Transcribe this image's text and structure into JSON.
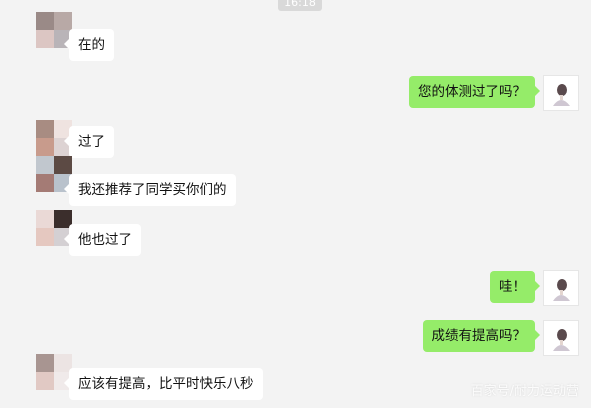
{
  "timestamp": "16:18",
  "colors": {
    "background": "#f3f3f3",
    "sent_bubble": "#95ec69",
    "received_bubble": "#ffffff"
  },
  "messages": [
    {
      "side": "left",
      "text": "在的"
    },
    {
      "side": "right",
      "text": "您的体测过了吗？"
    },
    {
      "side": "left",
      "text": "过了"
    },
    {
      "side": "left",
      "text": "我还推荐了同学买你们的"
    },
    {
      "side": "left",
      "text": "他也过了"
    },
    {
      "side": "right",
      "text": "哇！"
    },
    {
      "side": "right",
      "text": "成绩有提高吗？"
    },
    {
      "side": "left",
      "text": "应该有提高，比平时快乐八秒"
    }
  ],
  "watermark": "百家号/耐力运动营"
}
